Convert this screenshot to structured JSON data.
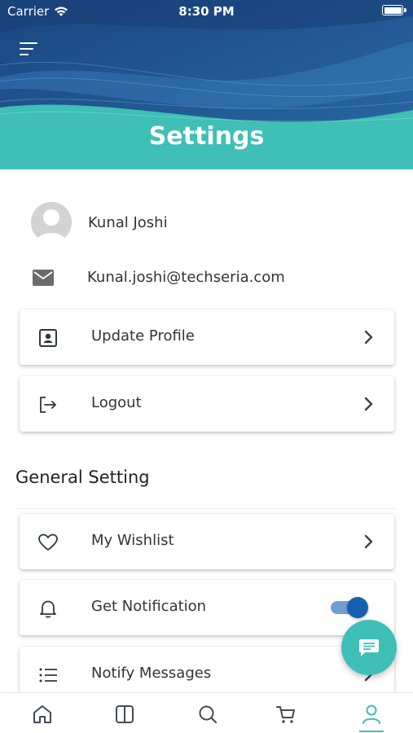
{
  "status_bar": {
    "carrier": "Carrier",
    "time": "8:30 PM"
  },
  "header": {
    "title": "Settings"
  },
  "profile": {
    "name": "Kunal Joshi",
    "email": "Kunal.joshi@techseria.com"
  },
  "account_actions": [
    {
      "label": "Update Profile",
      "icon": "profile-icon"
    },
    {
      "label": "Logout",
      "icon": "logout-icon"
    }
  ],
  "general_setting": {
    "title": "General Setting",
    "items": [
      {
        "label": "My Wishlist",
        "icon": "heart-icon"
      },
      {
        "label": "Get Notification",
        "icon": "bell-icon",
        "toggle_on": true
      },
      {
        "label": "Notify Messages",
        "icon": "list-icon"
      }
    ]
  },
  "bottom_nav": [
    {
      "icon": "home-icon"
    },
    {
      "icon": "book-icon"
    },
    {
      "icon": "search-icon"
    },
    {
      "icon": "cart-icon"
    },
    {
      "icon": "user-icon",
      "active": true
    }
  ],
  "colors": {
    "accent": "#3fbfb6",
    "header_dark": "#1f4f86",
    "toggle": "#1560ae"
  }
}
